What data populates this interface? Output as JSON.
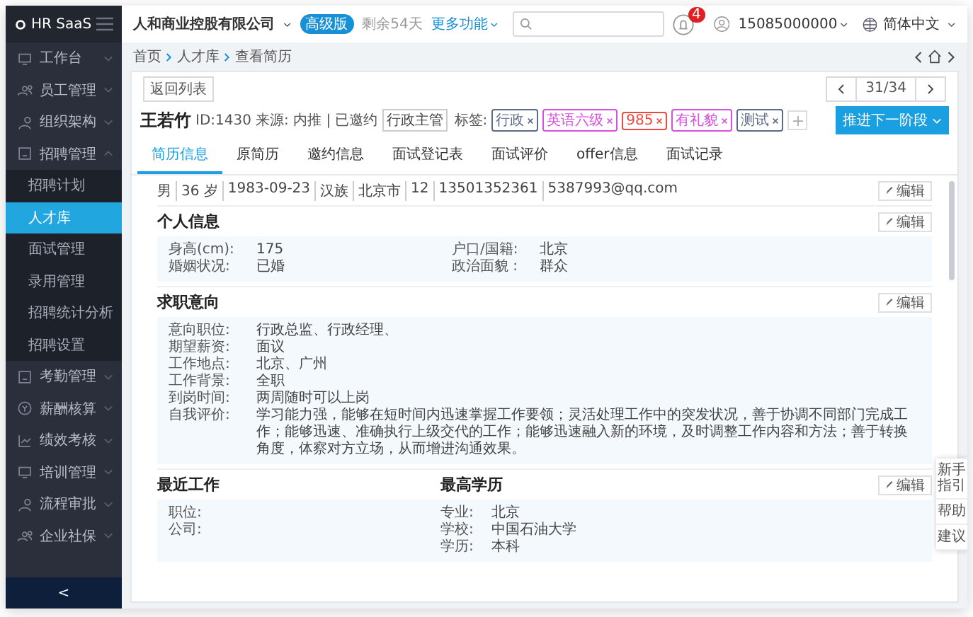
{
  "sidebar": {
    "logo": "HR SaaS",
    "items": [
      {
        "label": "工作台",
        "expanded": false,
        "selected": false
      },
      {
        "label": "员工管理",
        "expanded": false,
        "selected": false
      },
      {
        "label": "组织架构",
        "expanded": false,
        "selected": false
      },
      {
        "label": "招聘管理",
        "expanded": true,
        "selected": false,
        "children": [
          {
            "label": "招聘计划",
            "selected": false
          },
          {
            "label": "人才库",
            "selected": true
          },
          {
            "label": "面试管理",
            "selected": false
          },
          {
            "label": "录用管理",
            "selected": false
          },
          {
            "label": "招聘统计分析",
            "selected": false
          },
          {
            "label": "招聘设置",
            "selected": false
          }
        ]
      },
      {
        "label": "考勤管理",
        "expanded": false,
        "selected": false
      },
      {
        "label": "薪酬核算",
        "expanded": false,
        "selected": false
      },
      {
        "label": "绩效考核",
        "expanded": false,
        "selected": false
      },
      {
        "label": "培训管理",
        "expanded": false,
        "selected": false
      },
      {
        "label": "流程审批",
        "expanded": false,
        "selected": false
      },
      {
        "label": "企业社保",
        "expanded": false,
        "selected": false
      }
    ],
    "collapse": "<"
  },
  "topbar": {
    "company": "人和商业控股有限公司",
    "edition": "高级版",
    "remaining": "剩余54天",
    "more": "更多功能",
    "notifications": "4",
    "user": "15085000000",
    "language": "简体中文"
  },
  "breadcrumb": [
    "首页",
    "人才库",
    "查看简历"
  ],
  "card": {
    "back": "返回列表",
    "pager": "31/34",
    "name": "王若竹",
    "id": "ID:1430",
    "source": "来源: 内推 | 已邀约",
    "position": "行政主管",
    "tags_label": "标签:",
    "tags": [
      {
        "text": "行政",
        "color": "#5b6b86"
      },
      {
        "text": "英语六级",
        "color": "#d94fe0"
      },
      {
        "text": "985",
        "color": "#f0483e"
      },
      {
        "text": "有礼貌",
        "color": "#d94fe0"
      },
      {
        "text": "测试",
        "color": "#5b6b86"
      }
    ],
    "advance": "推进下一阶段",
    "tabs": [
      {
        "label": "简历信息",
        "selected": true
      },
      {
        "label": "原简历",
        "selected": false
      },
      {
        "label": "邀约信息",
        "selected": false
      },
      {
        "label": "面试登记表",
        "selected": false
      },
      {
        "label": "面试评价",
        "selected": false
      },
      {
        "label": "offer信息",
        "selected": false
      },
      {
        "label": "面试记录",
        "selected": false
      }
    ],
    "summary": [
      "男",
      "36 岁",
      "1983-09-23",
      "汉族",
      "北京市",
      "12",
      "13501352361",
      "5387993@qq.com"
    ],
    "summary_edit": "编辑",
    "personal": {
      "title": "个人信息",
      "edit": "编辑",
      "fields": [
        {
          "label": "身高(cm):",
          "value": "175"
        },
        {
          "label": "户口/国籍:",
          "value": "北京"
        },
        {
          "label": "婚姻状况:",
          "value": "已婚"
        },
        {
          "label": "政治面貌 :",
          "value": "群众"
        }
      ]
    },
    "intention": {
      "title": "求职意向",
      "edit": "编辑",
      "fields": [
        {
          "label": "意向职位:",
          "value": "行政总监、行政经理、"
        },
        {
          "label": "期望薪资:",
          "value": "面议"
        },
        {
          "label": "工作地点:",
          "value": "北京、广州"
        },
        {
          "label": "工作背景:",
          "value": "全职"
        },
        {
          "label": "到岗时间:",
          "value": "两周随时可以上岗"
        },
        {
          "label": "自我评价:",
          "value": "学习能力强，能够在短时间内迅速掌握工作要领；灵活处理工作中的突发状况，善于协调不同部门完成工作；能够迅速、准确执行上级交代的工作；能够迅速融入新的环境，及时调整工作内容和方法；善于转换角度，体察对方立场，从而增进沟通效果。"
        }
      ]
    },
    "work": {
      "title": "最近工作",
      "fields": [
        {
          "label": "职位:"
        },
        {
          "label": "公司:"
        }
      ]
    },
    "education": {
      "title": "最高学历",
      "edit": "编辑",
      "fields": [
        {
          "label": "专业:",
          "value": "北京"
        },
        {
          "label": "学校:",
          "value": "中国石油大学"
        },
        {
          "label": "学历:",
          "value": "本科"
        }
      ]
    }
  },
  "help_panel": [
    "新手指引",
    "帮助",
    "建议"
  ]
}
